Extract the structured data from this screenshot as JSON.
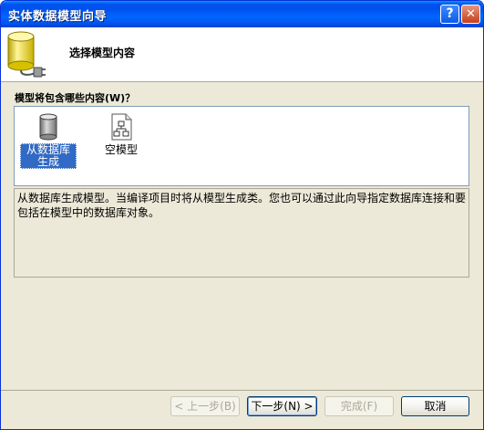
{
  "window": {
    "title": "实体数据模型向导",
    "help_glyph": "?",
    "close_glyph": "✕"
  },
  "header": {
    "title": "选择模型内容",
    "icon": "database-icon"
  },
  "question": "模型将包含哪些内容(W)？",
  "options": [
    {
      "label": "从数据库生成",
      "icon": "database-icon",
      "selected": true
    },
    {
      "label": "空模型",
      "icon": "empty-model-icon",
      "selected": false
    }
  ],
  "description": "从数据库生成模型。当编译项目时将从模型生成类。您也可以通过此向导指定数据库连接和要包括在模型中的数据库对象。",
  "buttons": {
    "back": "< 上一步(B)",
    "next": "下一步(N) >",
    "finish": "完成(F)",
    "cancel": "取消"
  },
  "colors": {
    "titlebar": "#0055ee",
    "selection": "#316ac5",
    "dialog_bg": "#ece9d8"
  }
}
